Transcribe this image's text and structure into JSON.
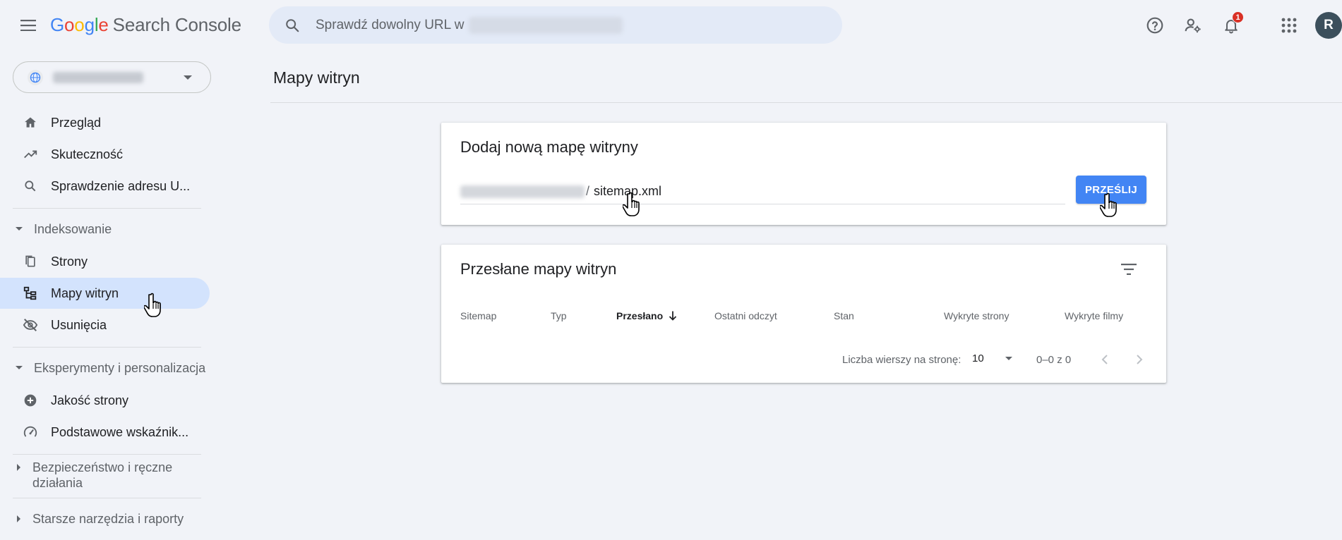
{
  "header": {
    "logo_letters": [
      "G",
      "o",
      "o",
      "g",
      "l",
      "e"
    ],
    "logo_product": "Search Console",
    "search_placeholder": "Sprawdź dowolny URL w",
    "notifications_count": "1",
    "avatar_initial": "R"
  },
  "sidebar": {
    "items": [
      {
        "label": "Przegląd",
        "icon": "home-icon"
      },
      {
        "label": "Skuteczność",
        "icon": "trending-up-icon"
      },
      {
        "label": "Sprawdzenie adresu U...",
        "icon": "search-icon"
      }
    ],
    "sections": [
      {
        "label": "Indeksowanie",
        "expanded": true,
        "items": [
          {
            "label": "Strony",
            "icon": "pages-icon"
          },
          {
            "label": "Mapy witryn",
            "icon": "sitemap-icon",
            "active": true
          },
          {
            "label": "Usunięcia",
            "icon": "visibility-off-icon"
          }
        ]
      },
      {
        "label": "Eksperymenty i personalizacja",
        "expanded": true,
        "items": [
          {
            "label": "Jakość strony",
            "icon": "add-circle-icon"
          },
          {
            "label": "Podstawowe wskaźnik...",
            "icon": "speed-gauge-icon"
          }
        ]
      },
      {
        "label": "Bezpieczeństwo i ręczne działania",
        "expanded": false
      },
      {
        "label": "Starsze narzędzia i raporty",
        "expanded": false
      }
    ]
  },
  "main": {
    "title": "Mapy witryn",
    "add_card": {
      "title": "Dodaj nową mapę witryny",
      "slash": "/",
      "input_value": "sitemap.xml",
      "submit_label": "PRZEŚLIJ"
    },
    "submitted_card": {
      "title": "Przesłane mapy witryn",
      "columns": [
        "Sitemap",
        "Typ",
        "Przesłano",
        "Ostatni odczyt",
        "Stan",
        "Wykryte strony",
        "Wykryte filmy"
      ],
      "sorted_column": "Przesłano",
      "rows_per_page_label": "Liczba wierszy na stronę:",
      "rows_per_page": "10",
      "range": "0–0 z 0"
    }
  },
  "colors": {
    "accent": "#4285f4",
    "active_nav": "#d3e3fd",
    "background": "#f1f3f8",
    "badge": "#d93025"
  }
}
